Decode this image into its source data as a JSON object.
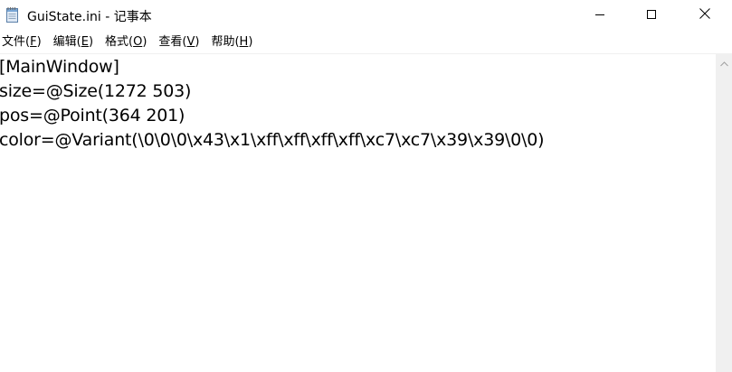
{
  "window": {
    "title": "GuiState.ini - 记事本",
    "icon": "notepad-icon"
  },
  "controls": {
    "minimize": "minimize-icon",
    "maximize": "maximize-icon",
    "close": "close-icon"
  },
  "menubar": {
    "items": [
      {
        "label_main": "文件(",
        "label_key": "F",
        "label_end": ")"
      },
      {
        "label_main": "编辑(",
        "label_key": "E",
        "label_end": ")"
      },
      {
        "label_main": "格式(",
        "label_key": "O",
        "label_end": ")"
      },
      {
        "label_main": "查看(",
        "label_key": "V",
        "label_end": ")"
      },
      {
        "label_main": "帮助(",
        "label_key": "H",
        "label_end": ")"
      }
    ]
  },
  "editor": {
    "lines": [
      "[MainWindow]",
      "size=@Size(1272 503)",
      "pos=@Point(364 201)",
      "color=@Variant(\\0\\0\\0\\x43\\x1\\xff\\xff\\xff\\xff\\xc7\\xc7\\x39\\x39\\0\\0)"
    ]
  },
  "scrollbar": {
    "up_arrow": "scroll-up-arrow-icon"
  }
}
